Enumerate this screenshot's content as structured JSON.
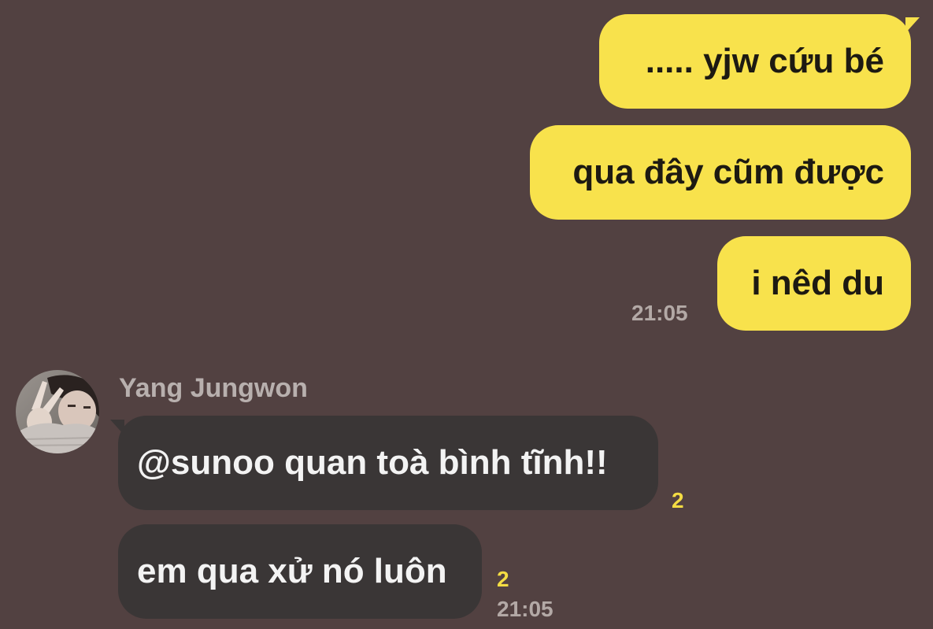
{
  "chat": {
    "outgoing": [
      {
        "text": "..... yjw cứu bé"
      },
      {
        "text": "qua đây cũm được"
      },
      {
        "text": "i nêd du"
      }
    ],
    "outgoing_time": "21:05",
    "sender": {
      "name": "Yang Jungwon",
      "avatar_icon": "avatar-photo-peace-sign"
    },
    "incoming": [
      {
        "text": "@sunoo quan toà bình tĩnh!!",
        "unread": "2"
      },
      {
        "text": "em qua xử nó luôn",
        "unread": "2"
      }
    ],
    "incoming_time": "21:05"
  },
  "colors": {
    "background": "#524141",
    "outgoing_bubble": "#f8e24c",
    "incoming_bubble": "#3a3636",
    "unread_count": "#f4dc43",
    "timestamp": "#b3a9a6"
  }
}
